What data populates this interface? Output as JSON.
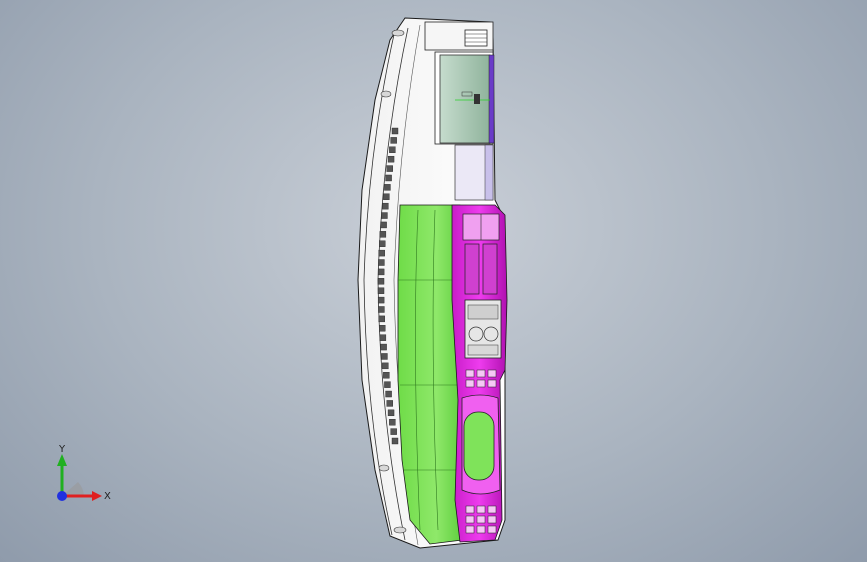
{
  "app": {
    "title": ""
  },
  "triad": {
    "x_label": "X",
    "y_label": "Y",
    "x_color": "#e02020",
    "y_color": "#20b020",
    "z_color": "#2030e0"
  },
  "model": {
    "name": "",
    "colors": {
      "body": "#ffffff",
      "green_panel": "#7fe35a",
      "magenta_panel": "#e020e0",
      "glass": "#a9c9b4",
      "purple_trim": "#6a3cc8",
      "edge": "#1a1a1a"
    }
  }
}
